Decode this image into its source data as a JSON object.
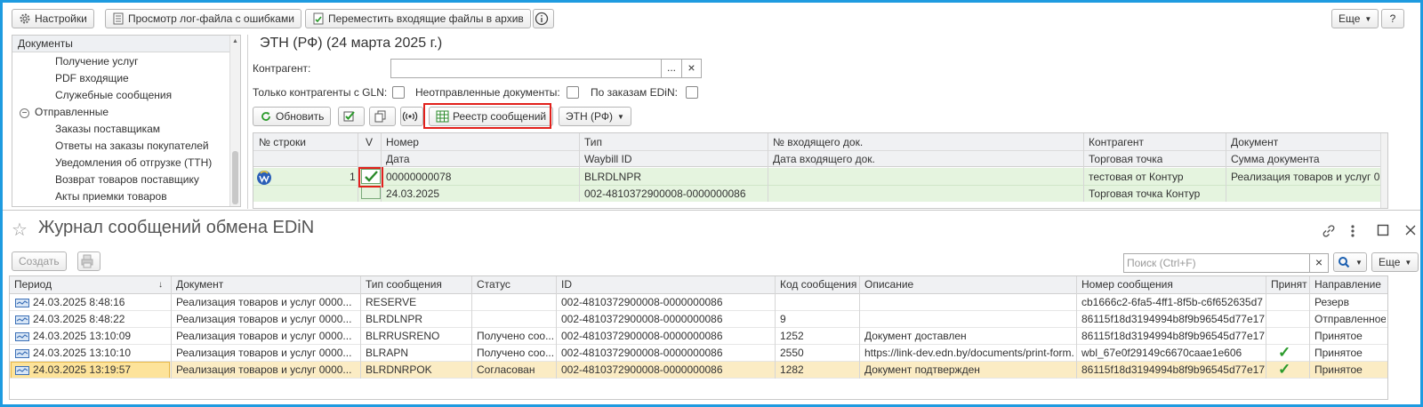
{
  "toolbar": {
    "settings": "Настройки",
    "log": "Просмотр лог-файла с ошибками",
    "archive": "Переместить входящие файлы в архив",
    "more": "Еще",
    "help": "?"
  },
  "tree": {
    "header": "Документы",
    "items": [
      {
        "label": "Получение услуг",
        "level": 2
      },
      {
        "label": "PDF входящие",
        "level": 2
      },
      {
        "label": "Служебные сообщения",
        "level": 2
      },
      {
        "label": "Отправленные",
        "level": 1
      },
      {
        "label": "Заказы поставщикам",
        "level": 2
      },
      {
        "label": "Ответы на заказы покупателей",
        "level": 2
      },
      {
        "label": "Уведомления об отгрузке (ТТН)",
        "level": 2
      },
      {
        "label": "Возврат товаров поставщику",
        "level": 2
      },
      {
        "label": "Акты приемки товаров",
        "level": 2
      }
    ]
  },
  "doc": {
    "title": "ЭТН (РФ) (24 марта 2025 г.)",
    "contractor_label": "Контрагент:",
    "contractor_value": "",
    "ellipsis": "...",
    "clear": "×",
    "gln_label": "Только контрагенты с GLN:",
    "unsent_label": "Неотправленные документы:",
    "edin_label": "По заказам EDiN:",
    "refresh": "Обновить",
    "registry": "Реестр сообщений",
    "etn": "ЭТН (РФ)",
    "columns_top": [
      "№ строки",
      "V",
      "Номер",
      "Тип",
      "№ входящего док.",
      "Контрагент",
      "Документ"
    ],
    "columns_bottom": [
      "Дата",
      "Waybill ID",
      "Дата входящего док.",
      "Торговая точка",
      "Сумма документа"
    ],
    "row": {
      "line": "1",
      "number": "00000000078",
      "date": "24.03.2025",
      "type": "BLRDLNPR",
      "waybill": "002-4810372900008-0000000086",
      "contractor": "тестовая от Контур",
      "point": "Торговая точка Контур",
      "document": "Реализация товаров и услуг 0"
    }
  },
  "journal": {
    "title": "Журнал сообщений обмена EDiN",
    "create": "Создать",
    "search_placeholder": "Поиск (Ctrl+F)",
    "clear": "×",
    "more": "Еще",
    "columns": [
      "Период",
      "Документ",
      "Тип сообщения",
      "Статус",
      "ID",
      "Код сообщения",
      "Описание",
      "Номер сообщения",
      "Принят",
      "Направление"
    ],
    "rows": [
      {
        "period": "24.03.2025 8:48:16",
        "document": "Реализация товаров и услуг 0000...",
        "type": "RESERVE",
        "status": "",
        "id": "002-4810372900008-0000000086",
        "code": "",
        "desc": "",
        "number": "cb1666c2-6fa5-4ff1-8f5b-c6f652635d7",
        "accepted": "",
        "direction": "Резерв"
      },
      {
        "period": "24.03.2025 8:48:22",
        "document": "Реализация товаров и услуг 0000...",
        "type": "BLRDLNPR",
        "status": "",
        "id": "002-4810372900008-0000000086",
        "code": "9",
        "desc": "",
        "number": "86115f18d3194994b8f9b96545d77e17",
        "accepted": "",
        "direction": "Отправленное"
      },
      {
        "period": "24.03.2025 13:10:09",
        "document": "Реализация товаров и услуг 0000...",
        "type": "BLRRUSRENO",
        "status": "Получено соо...",
        "id": "002-4810372900008-0000000086",
        "code": "1252",
        "desc": "Документ доставлен",
        "number": "86115f18d3194994b8f9b96545d77e17",
        "accepted": "",
        "direction": "Принятое"
      },
      {
        "period": "24.03.2025 13:10:10",
        "document": "Реализация товаров и услуг 0000...",
        "type": "BLRAPN",
        "status": "Получено соо...",
        "id": "002-4810372900008-0000000086",
        "code": "2550",
        "desc": "https://link-dev.edn.by/documents/print-form...",
        "number": "wbl_67e0f29149c6670caae1e606",
        "accepted": "✓",
        "direction": "Принятое"
      },
      {
        "period": "24.03.2025 13:19:57",
        "document": "Реализация товаров и услуг 0000...",
        "type": "BLRDNRPOK",
        "status": "Согласован",
        "id": "002-4810372900008-0000000086",
        "code": "1282",
        "desc": "Документ подтвержден",
        "number": "86115f18d3194994b8f9b96545d77e17",
        "accepted": "✓",
        "direction": "Принятое"
      }
    ]
  }
}
